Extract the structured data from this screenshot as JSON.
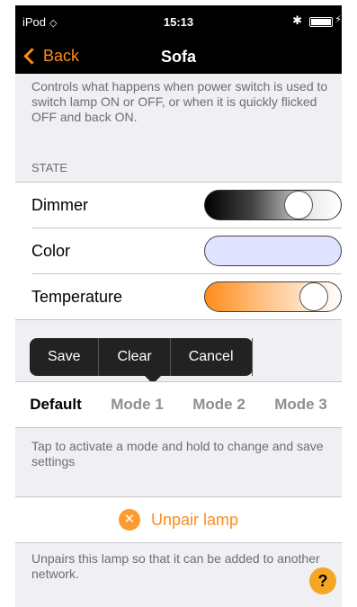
{
  "status": {
    "carrier": "iPod",
    "time": "15:13",
    "wifi_icon": "wifi-icon",
    "bluetooth_icon": "bluetooth-icon",
    "battery_icon": "battery-icon"
  },
  "nav": {
    "back_label": "Back",
    "title": "Sofa"
  },
  "intro_text": "Controls what happens when power switch is used to switch lamp ON or OFF, or when it is quickly flicked OFF and back ON.",
  "state": {
    "header": "STATE",
    "rows": [
      {
        "label": "Dimmer",
        "level": 0.74
      },
      {
        "label": "Color",
        "color": "#dfe3ff"
      },
      {
        "label": "Temperature",
        "level": 0.88
      }
    ]
  },
  "popup_menu": {
    "items": [
      "Save",
      "Clear",
      "Cancel"
    ]
  },
  "modes": {
    "items": [
      "Default",
      "Mode 1",
      "Mode 2",
      "Mode 3"
    ],
    "active": "Default",
    "hint": "Tap to activate a mode and hold to change and save settings"
  },
  "unpair": {
    "label": "Unpair lamp",
    "description": "Unpairs this lamp so that it can be added to another network."
  },
  "help": {
    "label": "?"
  },
  "colors": {
    "accent": "#ff8c1a",
    "help_badge": "#f5a623",
    "background": "#efeff4"
  }
}
